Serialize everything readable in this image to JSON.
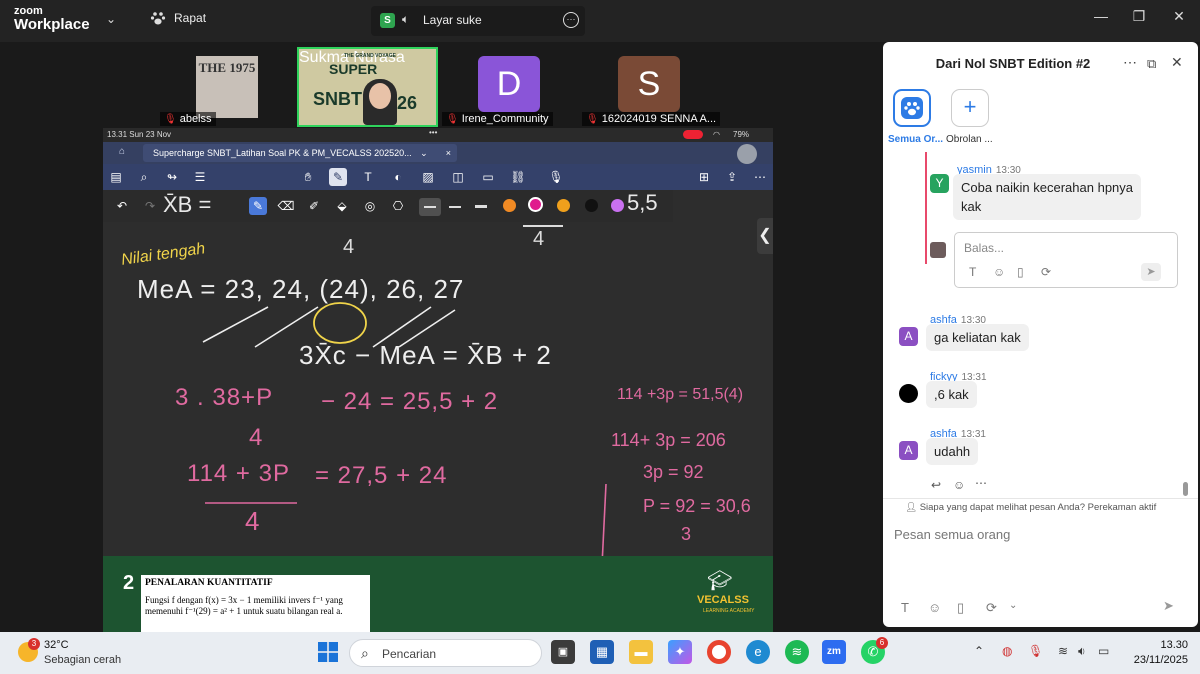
{
  "app": {
    "brand_line1": "zoom",
    "brand_line2": "Workplace"
  },
  "topbar": {
    "meeting_label": "Rapat",
    "share_badge": "S",
    "share_label": "Layar suke"
  },
  "participants": [
    {
      "name": "abelss",
      "avatar_text": "THE 1975"
    },
    {
      "name": "Sukma Nurasa"
    },
    {
      "name": "Irene_Community",
      "avatar_text": "D",
      "color": "#8a55d8"
    },
    {
      "name": "162024019 SENNA A...",
      "avatar_text": "S",
      "color": "#7a4a36"
    }
  ],
  "sukma_slide": {
    "line1": "THE GRAND VOYAGE",
    "line2": "SUPER",
    "line3": "SNBT",
    "line4": "26"
  },
  "ipad": {
    "status_time": "13.31  Sun 23 Nov",
    "status_dots": "•••",
    "battery": "79%",
    "tab_title": "Supercharge SNBT_Latihan Soal PK & PM_VECALSS 202520...",
    "tab_chevron": "⌄",
    "tab_close": "×"
  },
  "board": {
    "top_formula_left": "X̄B =",
    "top_formula_right": "5,5",
    "nilai_tengah": "Nilai tengah",
    "mea_line": "MeA = 23, 24, (24), 26, 27",
    "eq_main": "3X̄c − MeA = X̄B + 2",
    "eq_row1_left": "3 . 38+P",
    "eq_row1_mid": "− 24 = 25,5 + 2",
    "eq_row1_den": "4",
    "eq_row2_num": "114 + 3P",
    "eq_row2_right": "= 27,5 + 24",
    "eq_row2_den": "4",
    "side1": "114 +3p = 51,5(4)",
    "side2": "114+ 3p = 206",
    "side3": "3p = 92",
    "side4": "P = 92 = 30,6",
    "side4_den": "3",
    "den_top1": "4",
    "den_top2": "4"
  },
  "slide": {
    "number": "2",
    "heading": "PENALARAN KUANTITATIF",
    "line1": "Fungsi f dengan f(x) = 3x − 1 memiliki invers f⁻¹ yang",
    "line2": "memenuhi f⁻¹(29) = a² + 1 untuk suatu bilangan real a.",
    "brand": "VECALSS",
    "brand_sub": "LEARNING ACADEMY"
  },
  "chat": {
    "title": "Dari Nol SNBT Edition #2",
    "tab_all": "Semua Or...",
    "tab_chat": "Obrolan ...",
    "reply_placeholder": "Balas...",
    "input_placeholder": "Pesan semua orang",
    "visibility_note": "Siapa yang dapat melihat pesan Anda? Perekaman aktif",
    "messages": [
      {
        "name": "yasmin",
        "time": "13:30",
        "text": "Coba naikin kecerahan hpnya kak",
        "avatar": "Y",
        "color": "#27a35f"
      },
      {
        "name": "ashfa",
        "time": "13:30",
        "text": "ga keliatan kak",
        "avatar": "A",
        "color": "#8b4fc2"
      },
      {
        "name": "fickyy",
        "time": "13:31",
        "text": ",6 kak",
        "avatar": "",
        "color": "#000000"
      },
      {
        "name": "ashfa",
        "time": "13:31",
        "text": "udahh",
        "avatar": "A",
        "color": "#8b4fc2"
      }
    ]
  },
  "taskbar": {
    "weather_temp": "32°C",
    "weather_desc": "Sebagian cerah",
    "weather_badge": "3",
    "search_placeholder": "Pencarian",
    "time": "13.30",
    "date": "23/11/2025",
    "whatsapp_badge": "6"
  }
}
